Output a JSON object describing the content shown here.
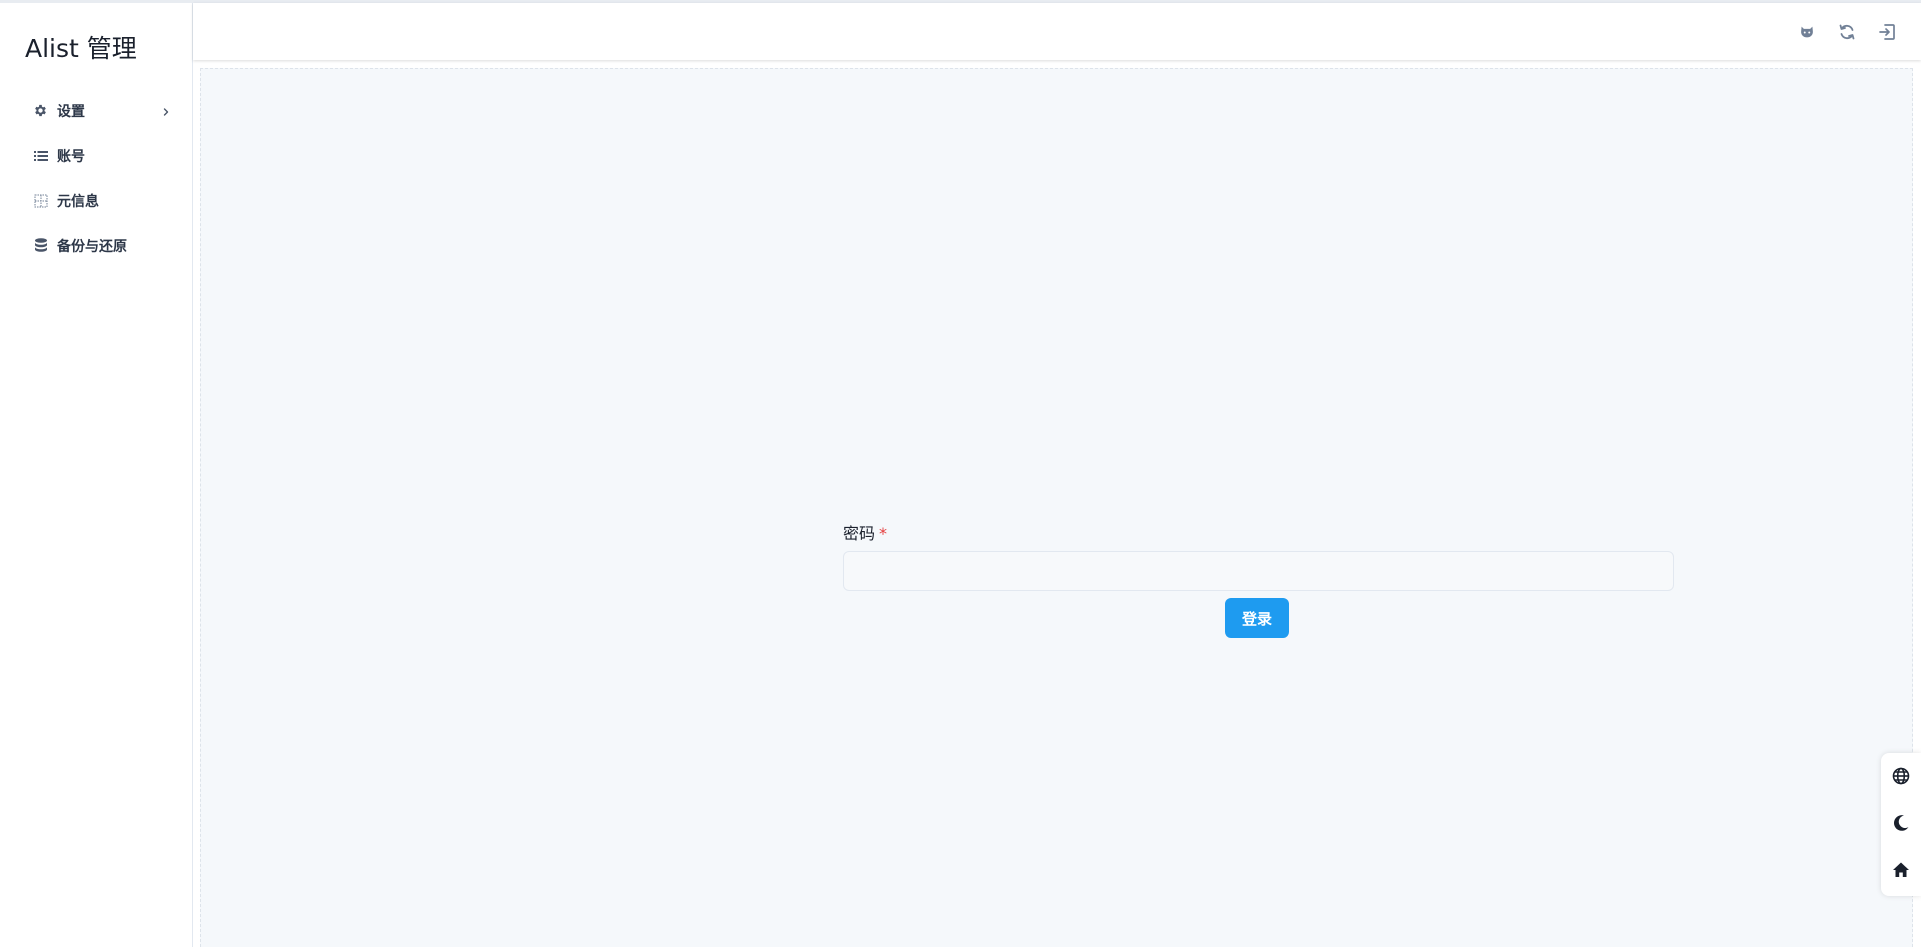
{
  "app": {
    "title": "Alist 管理"
  },
  "sidebar": {
    "items": [
      {
        "label": "设置",
        "icon": "gear-icon",
        "has_submenu": true
      },
      {
        "label": "账号",
        "icon": "list-icon"
      },
      {
        "label": "元信息",
        "icon": "grid-icon"
      },
      {
        "label": "备份与还原",
        "icon": "database-icon"
      }
    ]
  },
  "header": {
    "actions": [
      {
        "icon": "github-icon"
      },
      {
        "icon": "refresh-icon"
      },
      {
        "icon": "logout-icon"
      }
    ]
  },
  "login": {
    "password_label": "密码",
    "required_mark": "*",
    "password_value": "",
    "button_label": "登录"
  },
  "float_panel": {
    "items": [
      {
        "icon": "globe-icon"
      },
      {
        "icon": "moon-icon"
      },
      {
        "icon": "home-icon"
      }
    ]
  },
  "colors": {
    "accent": "#1e9bf0",
    "main_bg": "#f5f8fb",
    "required": "#e53e3e"
  }
}
